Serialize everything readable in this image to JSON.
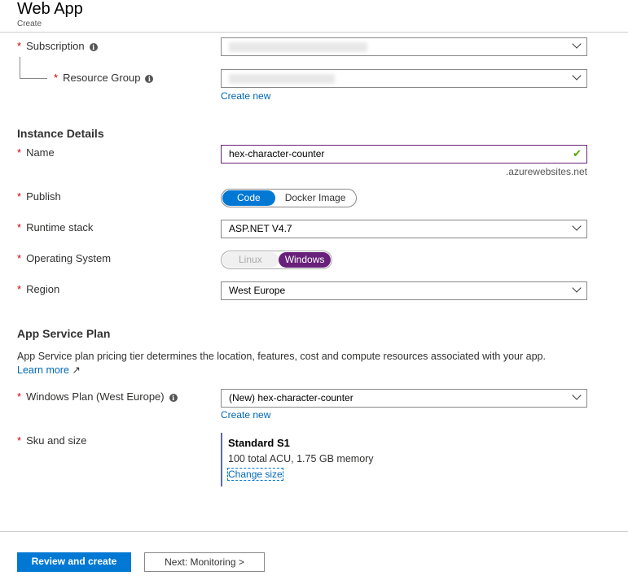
{
  "header": {
    "title": "Web App",
    "subtitle": "Create"
  },
  "project": {
    "subscription_label": "Subscription",
    "resource_group_label": "Resource Group",
    "create_new": "Create new"
  },
  "instance": {
    "heading": "Instance Details",
    "name_label": "Name",
    "name_value": "hex-character-counter",
    "name_suffix": ".azurewebsites.net",
    "publish_label": "Publish",
    "publish_options": [
      "Code",
      "Docker Image"
    ],
    "runtime_label": "Runtime stack",
    "runtime_value": "ASP.NET V4.7",
    "os_label": "Operating System",
    "os_options": [
      "Linux",
      "Windows"
    ],
    "region_label": "Region",
    "region_value": "West Europe"
  },
  "plan": {
    "heading": "App Service Plan",
    "description": "App Service plan pricing tier determines the location, features, cost and compute resources associated with your app.",
    "learn_more": "Learn more",
    "plan_label": "Windows Plan (West Europe)",
    "plan_value": "(New) hex-character-counter",
    "create_new": "Create new",
    "sku_label": "Sku and size",
    "sku_name": "Standard S1",
    "sku_desc": "100 total ACU, 1.75 GB memory",
    "change_size": "Change size"
  },
  "footer": {
    "review": "Review and create",
    "next": "Next: Monitoring >"
  },
  "colors": {
    "accent": "#0078d4",
    "purple": "#68217a",
    "required": "#c00"
  }
}
